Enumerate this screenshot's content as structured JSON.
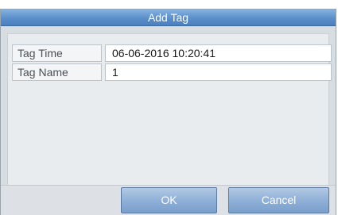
{
  "dialog": {
    "title": "Add Tag"
  },
  "fields": {
    "tag_time": {
      "label": "Tag Time",
      "value": "06-06-2016 10:20:41"
    },
    "tag_name": {
      "label": "Tag Name",
      "value": "1"
    }
  },
  "buttons": {
    "ok_label": "OK",
    "cancel_label": "Cancel"
  },
  "colors": {
    "title_bar": "#5b8fca",
    "button": "#8fb0d7",
    "dialog_bg": "#d8dde2"
  }
}
